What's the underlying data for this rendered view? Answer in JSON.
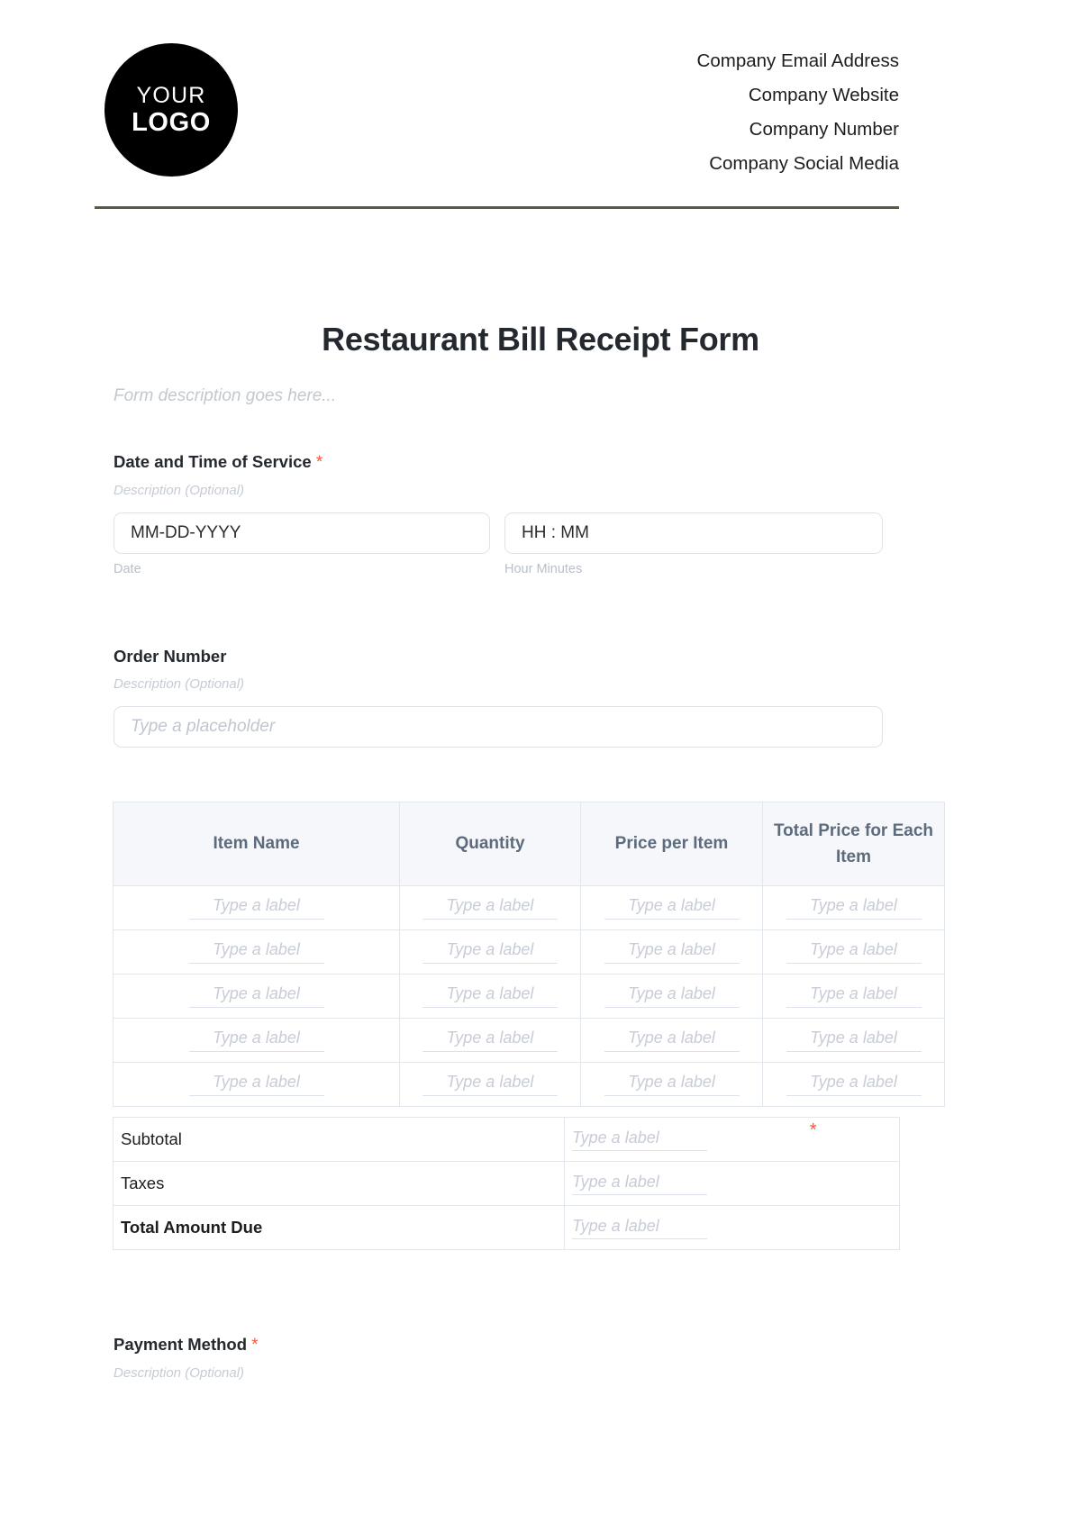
{
  "header": {
    "logo": {
      "top_text": "YOUR",
      "bottom_text": "LOGO"
    },
    "contact_lines": [
      "Company Email Address",
      "Company Website",
      "Company Number",
      "Company Social Media"
    ]
  },
  "colors": {
    "divider": "#565b42",
    "required_asterisk": "#ff5436",
    "table_header_bg": "#f5f7fa",
    "table_header_text": "#5d6b7c",
    "placeholder": "#c7ccd6",
    "border": "#e2e7ee",
    "title": "#24292f"
  },
  "title": "Restaurant Bill Receipt Form",
  "form_description": "Form description goes here...",
  "sections": {
    "date_time": {
      "label": "Date and Time of Service",
      "required_mark": "*",
      "description": "Description (Optional)",
      "date_placeholder": "MM-DD-YYYY",
      "time_placeholder": "HH : MM",
      "date_caption": "Date",
      "time_caption": "Hour Minutes"
    },
    "order_number": {
      "label": "Order Number",
      "description": "Description (Optional)",
      "placeholder": "Type a placeholder"
    },
    "payment_method": {
      "label": "Payment Method",
      "required_mark": "*",
      "description": "Description (Optional)"
    }
  },
  "items_table": {
    "columns": [
      "Item Name",
      "Quantity",
      "Price per Item",
      "Total Price for Each Item"
    ],
    "cell_placeholder": "Type a label",
    "row_count": 5,
    "rows": [
      [
        "Type a label",
        "Type a label",
        "Type a label",
        "Type a label"
      ],
      [
        "Type a label",
        "Type a label",
        "Type a label",
        "Type a label"
      ],
      [
        "Type a label",
        "Type a label",
        "Type a label",
        "Type a label"
      ],
      [
        "Type a label",
        "Type a label",
        "Type a label",
        "Type a label"
      ],
      [
        "Type a label",
        "Type a label",
        "Type a label",
        "Type a label"
      ]
    ]
  },
  "totals_table": {
    "rows": [
      {
        "label": "Subtotal",
        "value_placeholder": "Type a label",
        "bold": false,
        "required_mark": ""
      },
      {
        "label": "Taxes",
        "value_placeholder": "Type a label",
        "bold": false,
        "required_mark": ""
      },
      {
        "label": "Total Amount Due",
        "value_placeholder": "Type a label",
        "bold": true,
        "required_mark": "*"
      }
    ]
  }
}
